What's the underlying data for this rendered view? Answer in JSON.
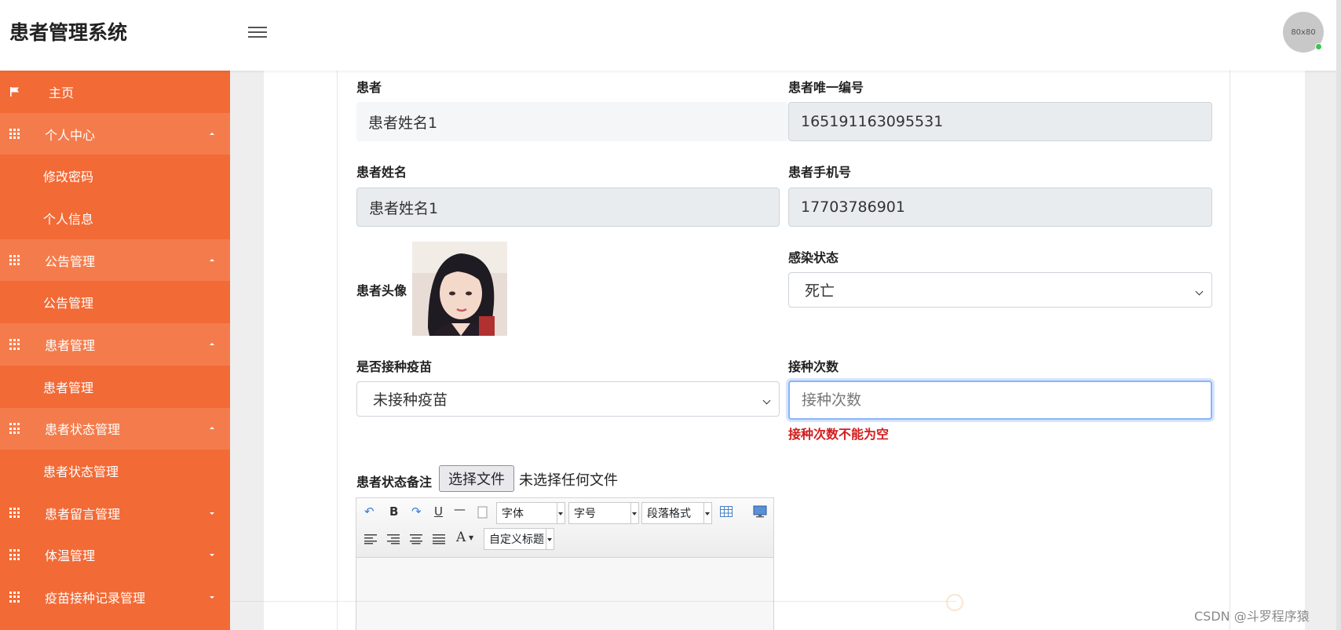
{
  "header": {
    "app_title": "患者管理系统",
    "avatar_text": "80x80"
  },
  "sidebar": {
    "items": [
      {
        "label": "主页",
        "icon": "flag-icon"
      },
      {
        "label": "个人中心",
        "icon": "grid-icon",
        "expanded": true
      },
      {
        "label": "修改密码"
      },
      {
        "label": "个人信息"
      },
      {
        "label": "公告管理",
        "icon": "grid-icon",
        "expanded": true
      },
      {
        "label": "公告管理"
      },
      {
        "label": "患者管理",
        "icon": "grid-icon",
        "expanded": true
      },
      {
        "label": "患者管理"
      },
      {
        "label": "患者状态管理",
        "icon": "grid-icon",
        "expanded": true
      },
      {
        "label": "患者状态管理"
      },
      {
        "label": "患者留言管理",
        "icon": "grid-icon",
        "expanded": false
      },
      {
        "label": "体温管理",
        "icon": "grid-icon",
        "expanded": false
      },
      {
        "label": "疫苗接种记录管理",
        "icon": "grid-icon",
        "expanded": false
      }
    ]
  },
  "form": {
    "patient": {
      "label": "患者",
      "value": "患者姓名1"
    },
    "patient_id": {
      "label": "患者唯一编号",
      "value": "165191163095531"
    },
    "patient_name": {
      "label": "患者姓名",
      "value": "患者姓名1"
    },
    "patient_phone": {
      "label": "患者手机号",
      "value": "17703786901"
    },
    "patient_avatar": {
      "label": "患者头像"
    },
    "infection_status": {
      "label": "感染状态",
      "value": "死亡"
    },
    "vaccinated": {
      "label": "是否接种疫苗",
      "value": "未接种疫苗"
    },
    "dose_count": {
      "label": "接种次数",
      "placeholder": "接种次数",
      "value": "",
      "error": "接种次数不能为空"
    },
    "status_note": {
      "label": "患者状态备注",
      "file_button": "选择文件",
      "file_status": "未选择任何文件"
    }
  },
  "editor": {
    "font_label": "字体",
    "size_label": "字号",
    "paragraph_label": "段落格式",
    "custom_title_label": "自定义标题",
    "bold": "B",
    "underline": "U",
    "font_color": "A"
  },
  "watermark": "CSDN @斗罗程序猿",
  "colors": {
    "sidebar": "#f26a36",
    "sidebar_section": "#f47c4c",
    "error": "#d21c1c",
    "focus": "#8ab4f8"
  }
}
